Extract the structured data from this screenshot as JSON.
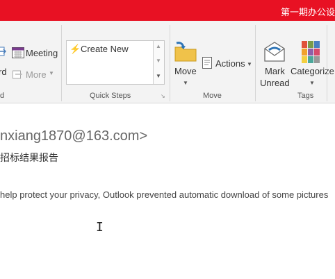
{
  "window": {
    "title": "第一期办公设"
  },
  "ribbon": {
    "respond": {
      "partial_left_label": "rd",
      "meeting_label": "Meeting",
      "more_label": "More",
      "group_label_partial": "d"
    },
    "quick_steps": {
      "create_new_label": "Create New",
      "group_label": "Quick Steps"
    },
    "move": {
      "move_label": "Move",
      "actions_label": "Actions",
      "group_label": "Move"
    },
    "tags": {
      "mark_unread_line1": "Mark",
      "mark_unread_line2": "Unread",
      "categorize_label": "Categorize",
      "group_label": "Tags"
    }
  },
  "message": {
    "from": "nxiang1870@163.com>",
    "subject": "招标结果报告",
    "info_bar": "help protect your privacy, Outlook prevented automatic download of some pictures"
  },
  "colors": {
    "titlebar": "#e81123",
    "ribbon_bg": "#f3f3f3"
  }
}
